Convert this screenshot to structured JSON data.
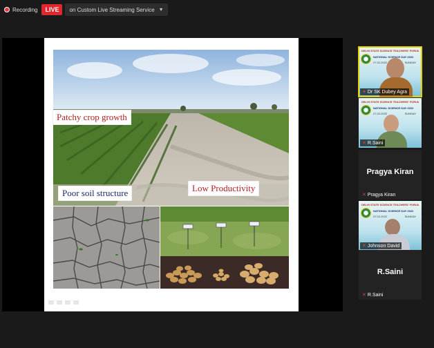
{
  "toolbar": {
    "recording_label": "Recording",
    "live_label": "LIVE",
    "stream_label": "on Custom Live Streaming Service"
  },
  "slide": {
    "label_patchy": "Patchy crop growth",
    "label_soil": "Poor soil structure",
    "label_productivity": "Low Productivity"
  },
  "gallery": {
    "banner": "DELHI STATE SCIENCE TEACHERS' FORUM (REGD.)",
    "event": "NATIONAL SCIENCE DAY 2022",
    "date": "27.02.2022",
    "day": "SUNDAY",
    "participants": [
      {
        "name": "Dr SK Dubey Agra"
      },
      {
        "name": "R.Saini"
      },
      {
        "name": "Pragya Kiran",
        "display": "Pragya Kiran"
      },
      {
        "name": "Johnson David"
      },
      {
        "name": "R.Saini",
        "display": "R.Saini"
      }
    ]
  },
  "colors": {
    "live_red": "#e0272f",
    "active_speaker": "#e3d200",
    "label_red": "#b32020",
    "label_navy": "#1b2a6b"
  }
}
